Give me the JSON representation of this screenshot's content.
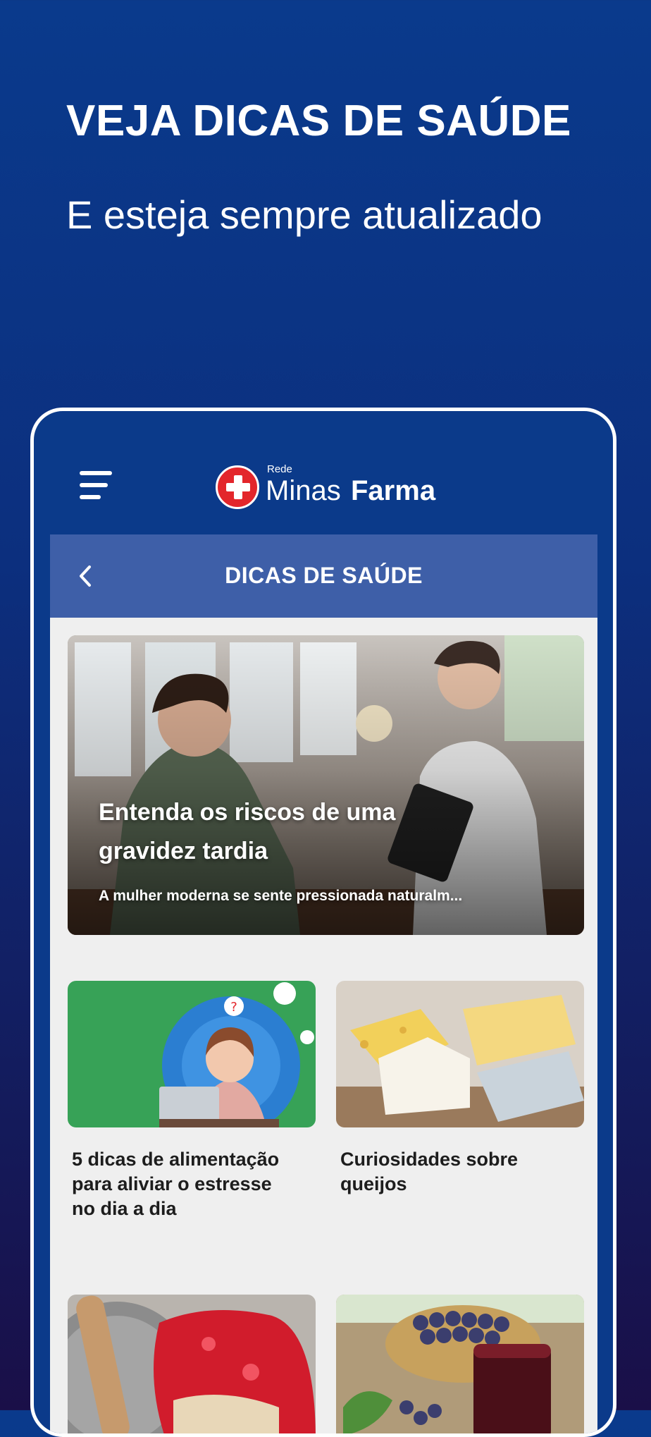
{
  "promo": {
    "title": "VEJA DICAS DE SAÚDE",
    "subtitle": "E esteja sempre atualizado"
  },
  "app": {
    "menu_icon": "hamburger-menu-icon",
    "logo": {
      "rede": "Rede",
      "minas": "Minas",
      "farma": "Farma"
    },
    "page_title": "DICAS DE SAÚDE",
    "back_icon": "chevron-left-icon"
  },
  "featured": {
    "title": "Entenda os riscos de uma gravidez tardia",
    "description": "A mulher moderna se sente pressionada naturalm..."
  },
  "articles": [
    {
      "title": "5 dicas de alimentação para aliviar o estresse no dia a dia"
    },
    {
      "title": "Curiosidades sobre queijos"
    },
    {
      "title": ""
    },
    {
      "title": ""
    }
  ],
  "colors": {
    "background_top": "#0a3a8c",
    "background_bottom": "#1a0f48",
    "subheader": "#3e5fa8",
    "logo_red": "#e3262b",
    "content_bg": "#efefef"
  }
}
